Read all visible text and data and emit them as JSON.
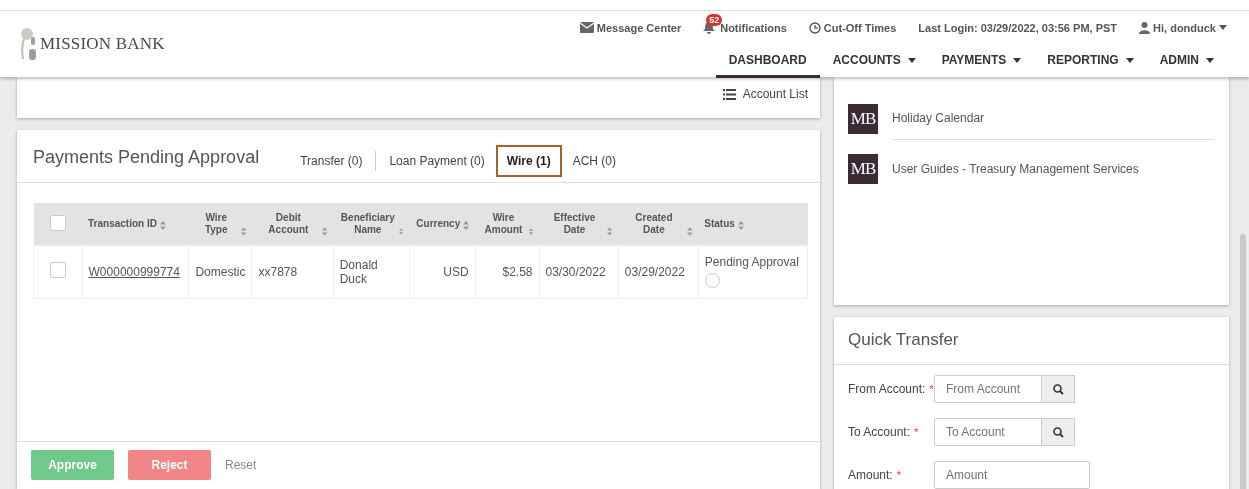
{
  "header": {
    "logo": "MISSION BANK",
    "utilities": [
      {
        "kind": "mail",
        "label": "Message Center"
      },
      {
        "kind": "bell",
        "label": "Notifications",
        "badge": "52"
      },
      {
        "kind": "clock",
        "label": "Cut-Off Times"
      },
      {
        "kind": "text",
        "label": "Last Login: 03/29/2022, 03:56 PM, PST"
      },
      {
        "kind": "user",
        "label": "Hi, donduck",
        "dropdown": true
      }
    ],
    "nav": [
      {
        "label": "DASHBOARD",
        "selected": true,
        "dropdown": false
      },
      {
        "label": "ACCOUNTS",
        "selected": false,
        "dropdown": true
      },
      {
        "label": "PAYMENTS",
        "selected": false,
        "dropdown": true
      },
      {
        "label": "REPORTING",
        "selected": false,
        "dropdown": true
      },
      {
        "label": "ADMIN",
        "selected": false,
        "dropdown": true
      }
    ]
  },
  "accounts_card": {
    "link": "Account List"
  },
  "payments": {
    "title": "Payments Pending Approval",
    "tabs": [
      {
        "label": "Transfer (0)",
        "selected": false
      },
      {
        "label": "Loan Payment (0)",
        "selected": false
      },
      {
        "label": "Wire (1)",
        "selected": true
      },
      {
        "label": "ACH (0)",
        "selected": false
      }
    ],
    "select_all_checked": false,
    "columns": [
      {
        "label": "Transaction ID"
      },
      {
        "label": "Wire Type"
      },
      {
        "label": "Debit Account"
      },
      {
        "label": "Beneficiary Name"
      },
      {
        "label": "Currency"
      },
      {
        "label": "Wire Amount"
      },
      {
        "label": "Effective Date"
      },
      {
        "label": "Created Date"
      },
      {
        "label": "Status"
      }
    ],
    "rows": [
      {
        "checked": false,
        "cells": [
          "W000000999774",
          "Domestic",
          "xx7878",
          "Donald Duck",
          "USD",
          "$2.58",
          "03/30/2022",
          "03/29/2022"
        ],
        "status": "Pending Approval",
        "status_selected": false
      }
    ],
    "buttons": [
      {
        "label": "Approve",
        "kind": "approve"
      },
      {
        "label": "Reject",
        "kind": "reject"
      },
      {
        "label": "Reset",
        "kind": "link"
      }
    ]
  },
  "resources": [
    {
      "icon": "MB",
      "label": "Holiday Calendar"
    },
    {
      "icon": "MB",
      "label": "User Guides - Treasury Management Services"
    }
  ],
  "quick_transfer": {
    "title": "Quick Transfer",
    "fields": [
      {
        "label": "From Account:",
        "mark": "*",
        "placeholder": "From Account",
        "search": true
      },
      {
        "label": "To Account:",
        "mark": "*",
        "placeholder": "To Account",
        "search": true
      },
      {
        "label": "Amount:",
        "mark": "*",
        "placeholder": "Amount",
        "search": false
      }
    ]
  }
}
